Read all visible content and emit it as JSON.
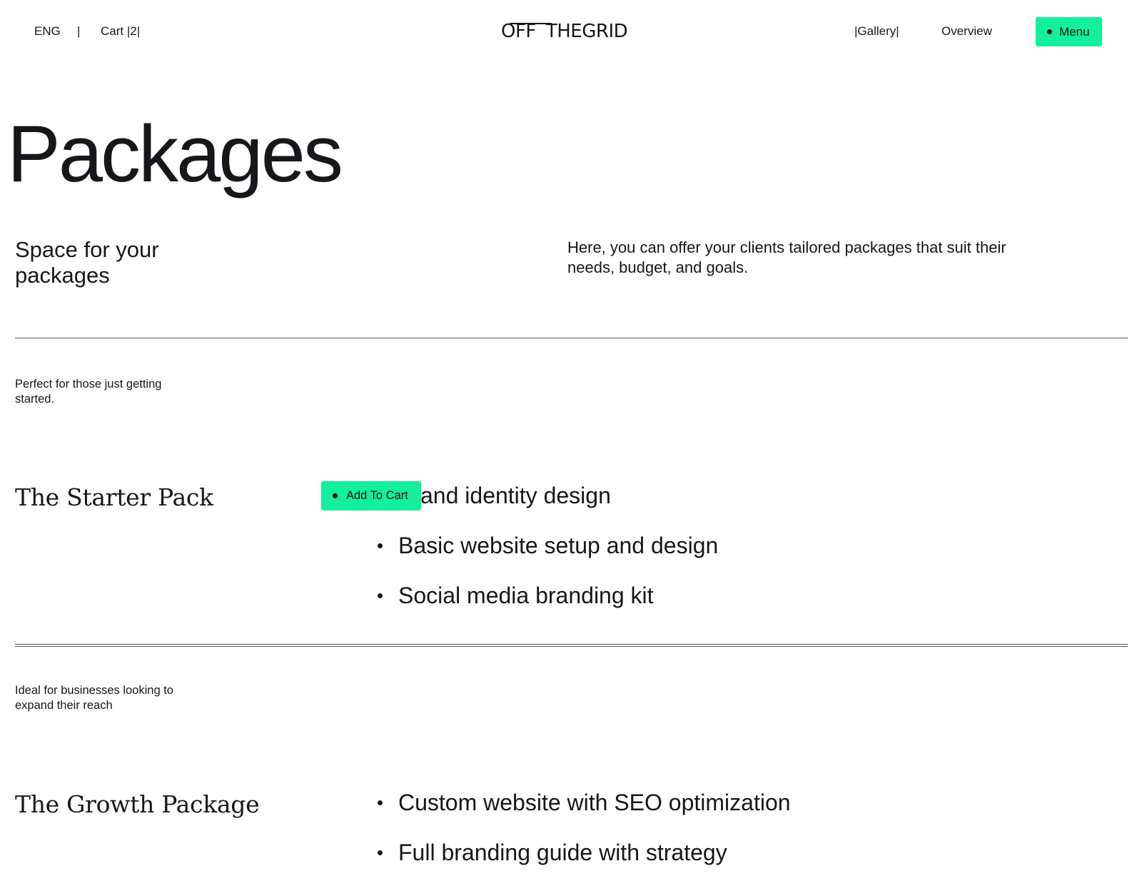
{
  "header": {
    "lang": "ENG",
    "separator": "|",
    "cart": "Cart |2|",
    "logo_a": "OFF",
    "logo_b": "THEGRID",
    "gallery": "|Gallery|",
    "overview": "Overview",
    "menu": "Menu"
  },
  "hero": {
    "title": "Packages",
    "subtitle_line1": "Space for your",
    "subtitle_line2": "packages",
    "description": "Here, you can offer your clients tailored packages that suit their needs, budget, and goals."
  },
  "packages": [
    {
      "tagline": "Perfect for those just getting started.",
      "name": "The Starter Pack",
      "add_to_cart": "Add To Cart",
      "features": [
        "and identity design",
        "Basic website setup and design",
        "Social media branding kit"
      ]
    },
    {
      "tagline": "Ideal for businesses looking to expand their reach",
      "name": "The Growth Package",
      "features": [
        "Custom website with SEO optimization",
        "Full branding guide with strategy"
      ]
    }
  ],
  "colors": {
    "accent": "#13ef9a",
    "text": "#15171a",
    "background": "#ffffff"
  }
}
